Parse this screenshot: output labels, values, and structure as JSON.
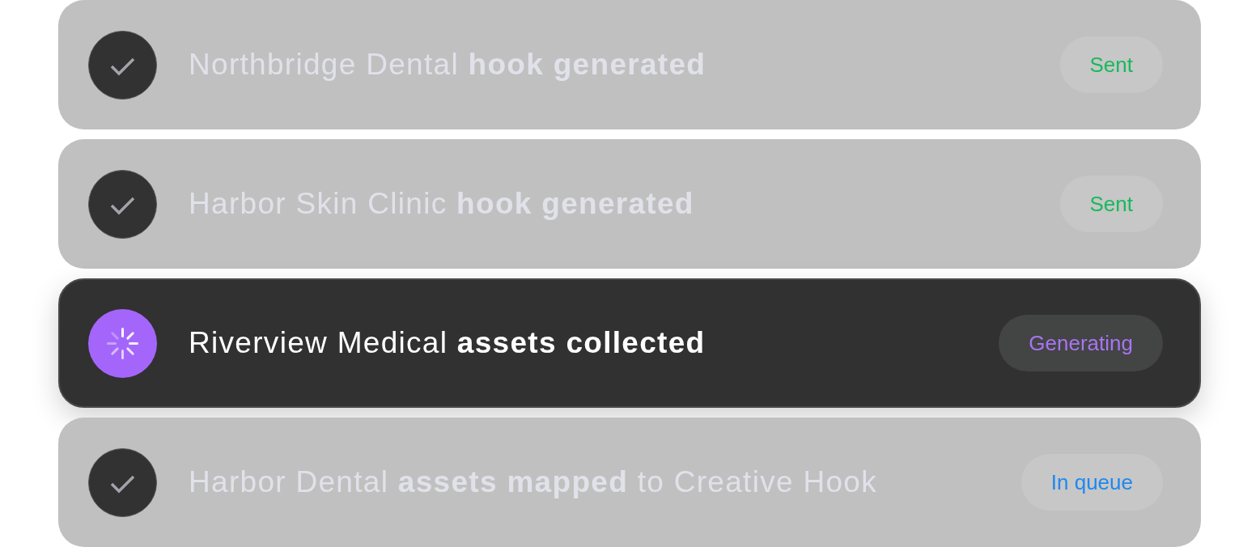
{
  "items": [
    {
      "kind": "done",
      "title": "Northbridge Dental **hook generated**",
      "badge": {
        "label": "Sent",
        "color": "#19b85e"
      }
    },
    {
      "kind": "done",
      "title": "Harbor Skin Clinic **hook generated**",
      "badge": {
        "label": "Sent",
        "color": "#19b85e"
      }
    },
    {
      "kind": "active",
      "title": "Riverview Medical **assets collected**",
      "badge": {
        "label": "Generating",
        "color": "#a874f2"
      }
    },
    {
      "kind": "done",
      "title": "Harbor Dental **assets mapped** to Creative Hook",
      "badge": {
        "label": "In queue",
        "color": "#1f88f0"
      }
    }
  ]
}
